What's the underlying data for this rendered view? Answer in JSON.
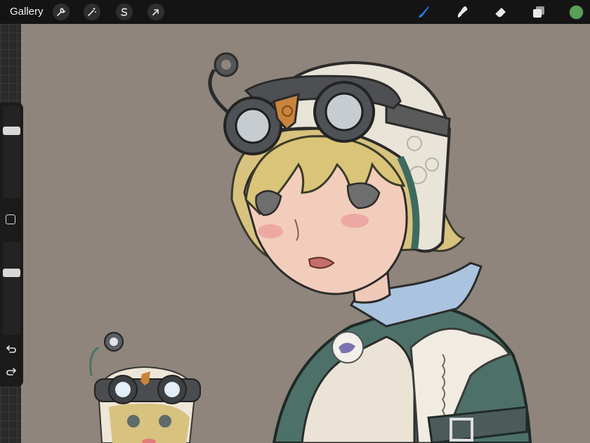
{
  "topbar": {
    "gallery_label": "Gallery",
    "left_tools": [
      {
        "name": "actions",
        "icon": "wrench-icon"
      },
      {
        "name": "adjustments",
        "icon": "magic-wand-icon"
      },
      {
        "name": "selection",
        "icon": "selection-s-icon"
      },
      {
        "name": "transform",
        "icon": "arrow-cursor-icon"
      }
    ],
    "right_tools": [
      {
        "name": "brush",
        "icon": "brush-icon",
        "active": true
      },
      {
        "name": "smudge",
        "icon": "smudge-icon",
        "active": false
      },
      {
        "name": "eraser",
        "icon": "eraser-icon",
        "active": false
      },
      {
        "name": "layers",
        "icon": "layers-icon",
        "active": false
      }
    ],
    "current_color": "#5a9f5a",
    "active_tool_color": "#1a7ff0"
  },
  "sidebar": {
    "brush_size_level": 0.75,
    "opacity_level": 0.68,
    "modify_icon": "square-icon",
    "undo_icon": "undo-icon",
    "redo_icon": "redo-icon"
  },
  "canvas": {
    "background_color": "#8f857c",
    "subject": "character-illustration"
  }
}
